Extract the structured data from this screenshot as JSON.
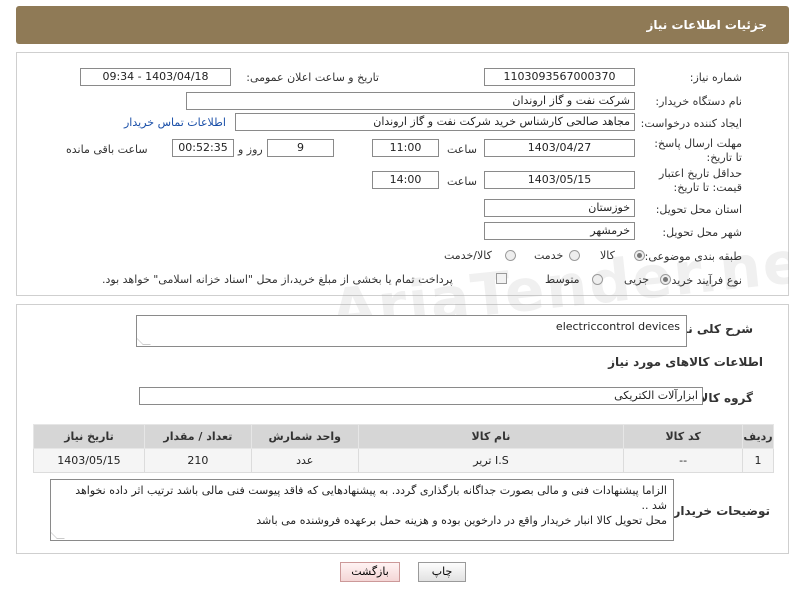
{
  "header": {
    "title": "جزئیات اطلاعات نیاز"
  },
  "form": {
    "need_number_label": "شماره نیاز:",
    "need_number": "1103093567000370",
    "announce_label": "تاریخ و ساعت اعلان عمومی:",
    "announce_value": "1403/04/18 - 09:34",
    "buyer_org_label": "نام دستگاه خریدار:",
    "buyer_org": "شرکت نفت و گاز اروندان",
    "requester_label": "ایجاد کننده درخواست:",
    "requester": "مجاهد صالحی کارشناس خرید شرکت نفت و گاز اروندان",
    "contact_link": "اطلاعات تماس خریدار",
    "reply_deadline_label": "مهلت ارسال پاسخ: تا تاریخ:",
    "reply_date": "1403/04/27",
    "time_label": "ساعت",
    "reply_time": "11:00",
    "days_value": "9",
    "days_label": "روز و",
    "remaining_time": "00:52:35",
    "remaining_label": "ساعت باقی مانده",
    "price_valid_label": "حداقل تاریخ اعتبار قیمت: تا تاریخ:",
    "price_date": "1403/05/15",
    "price_time": "14:00",
    "province_label": "استان محل تحویل:",
    "province": "خوزستان",
    "city_label": "شهر محل تحویل:",
    "city": "خرمشهر",
    "category_label": "طبقه بندی موضوعی:",
    "cat_goods": "کالا",
    "cat_service": "خدمت",
    "cat_both": "کالا/خدمت",
    "process_label": "نوع فرآیند خرید :",
    "proc_partial": "جزیی",
    "proc_medium": "متوسط",
    "payment_note": "پرداخت تمام یا بخشی از مبلغ خرید،از محل \"اسناد خزانه اسلامی\" خواهد بود."
  },
  "details": {
    "desc_label": "شرح کلی نیاز:",
    "desc_value": "electriccontrol devices",
    "goods_info_title": "اطلاعات کالاهای مورد نیاز",
    "group_label": "گروه کالا:",
    "group_value": "ابزارآلات الکتریکی",
    "table": {
      "headers": [
        "ردیف",
        "کد کالا",
        "نام کالا",
        "واحد شمارش",
        "تعداد / مقدار",
        "تاریخ نیاز"
      ],
      "rows": [
        [
          "1",
          "--",
          "I.S تریر",
          "عدد",
          "210",
          "1403/05/15"
        ]
      ]
    },
    "buyer_notes_label": "توضیحات خریدار:",
    "buyer_notes_line1": "الزاما  پیشنهادات فنی و مالی بصورت جداگانه بارگذاری گردد. به پیشنهادهایی که فاقد پیوست فنی مالی باشد ترتیب اثر داده نخواهد شد ..",
    "buyer_notes_line2": "محل تحویل کالا انبار خریدار واقع در  دارخوین بوده و هزینه حمل برعهده فروشنده می باشد"
  },
  "buttons": {
    "print": "چاپ",
    "back": "بازگشت"
  },
  "watermark": "AriaTender.neT"
}
